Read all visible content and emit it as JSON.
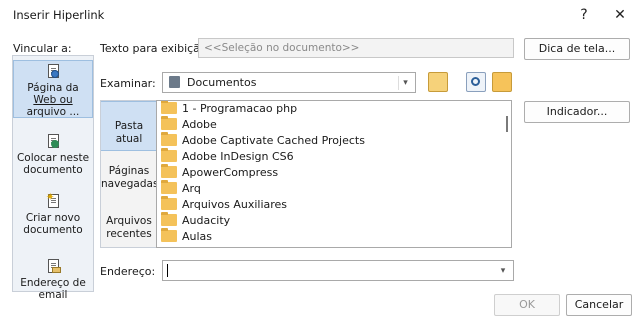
{
  "dialog": {
    "title": "Inserir Hiperlink",
    "help_label": "?",
    "close_label": "✕"
  },
  "link_to": {
    "label": "Vincular a:",
    "items": [
      {
        "label": "Página da Web ou arquivo ...",
        "line1": "Página da",
        "line2": "Web ou",
        "line3": "arquivo ...",
        "icon": "web-page-icon",
        "active": true
      },
      {
        "label": "Colocar neste documento",
        "line1": "Colocar neste",
        "line2": "documento",
        "icon": "place-in-document-icon"
      },
      {
        "label": "Criar novo documento",
        "line1": "Criar novo",
        "line2": "documento",
        "icon": "new-document-icon"
      },
      {
        "label": "Endereço de email",
        "line1": "Endereço de",
        "line2": "email",
        "icon": "email-address-icon"
      }
    ]
  },
  "display_text": {
    "label": "Texto para exibição:",
    "value": "<<Seleção no documento>>"
  },
  "screentip_button": "Dica de tela...",
  "look_in": {
    "label": "Examinar:",
    "value": "Documentos"
  },
  "bookmark_button": "Indicador...",
  "browse_tabs": [
    {
      "line1": "Pasta atual",
      "line2": "",
      "active": true
    },
    {
      "line1": "Páginas",
      "line2": "navegadas"
    },
    {
      "line1": "Arquivos",
      "line2": "recentes"
    }
  ],
  "files": [
    "1 - Programacao php",
    "Adobe",
    "Adobe Captivate Cached Projects",
    "Adobe InDesign CS6",
    "ApowerCompress",
    "Arq",
    "Arquivos Auxiliares",
    "Audacity",
    "Aulas"
  ],
  "address": {
    "label": "Endereço:",
    "value": ""
  },
  "ok_button": "OK",
  "cancel_button": "Cancelar",
  "colors": {
    "accent_active": "#cfe0f3",
    "folder": "#f4c25a"
  }
}
